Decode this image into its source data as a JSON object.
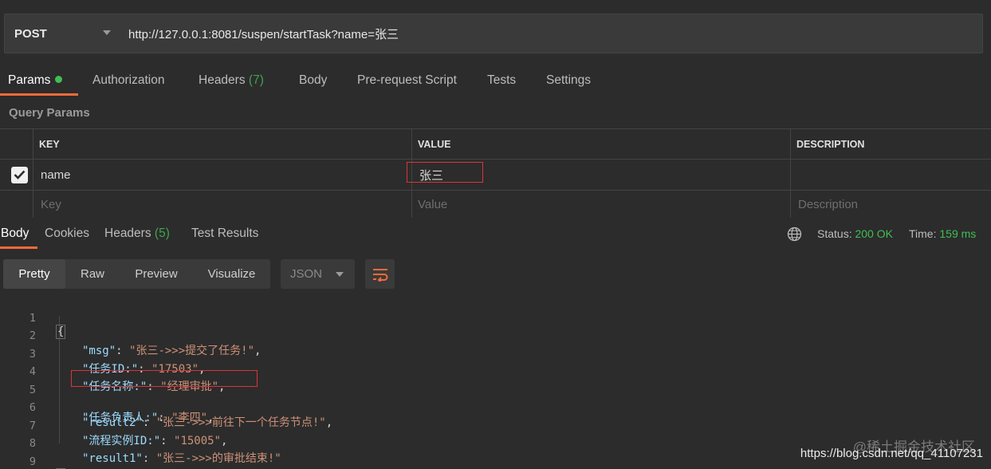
{
  "request": {
    "method": "POST",
    "url": "http://127.0.0.1:8081/suspen/startTask?name=张三"
  },
  "req_tabs": [
    {
      "label": "Params",
      "count": ""
    },
    {
      "label": "Authorization",
      "count": ""
    },
    {
      "label": "Headers",
      "count": "(7)"
    },
    {
      "label": "Body",
      "count": ""
    },
    {
      "label": "Pre-request Script",
      "count": ""
    },
    {
      "label": "Tests",
      "count": ""
    },
    {
      "label": "Settings",
      "count": ""
    }
  ],
  "query_params": {
    "title": "Query Params",
    "columns": [
      "KEY",
      "VALUE",
      "DESCRIPTION"
    ],
    "rows": [
      {
        "key": "name",
        "value": "张三",
        "description": ""
      }
    ],
    "placeholders": {
      "key": "Key",
      "value": "Value",
      "description": "Description"
    }
  },
  "res_tabs": [
    {
      "label": "Body",
      "count": ""
    },
    {
      "label": "Cookies",
      "count": ""
    },
    {
      "label": "Headers",
      "count": "(5)"
    },
    {
      "label": "Test Results",
      "count": ""
    }
  ],
  "status": {
    "status_label": "Status:",
    "status_value": "200 OK",
    "time_label": "Time:",
    "time_value": "159 ms"
  },
  "view_modes": [
    "Pretty",
    "Raw",
    "Preview",
    "Visualize"
  ],
  "format": "JSON",
  "code_lines": [
    {
      "n": "1",
      "key": "",
      "value": "",
      "raw": "{"
    },
    {
      "n": "2",
      "key": "\"msg\"",
      "value": "\"张三->>>提交了任务!\"",
      "raw": ""
    },
    {
      "n": "3",
      "key": "\"任务ID:\"",
      "value": "\"17503\"",
      "raw": ""
    },
    {
      "n": "4",
      "key": "\"任务名称:\"",
      "value": "\"经理审批\"",
      "raw": ""
    },
    {
      "n": "5",
      "key": "\"任务负责人:\"",
      "value": "\"李四\"",
      "raw": ""
    },
    {
      "n": "6",
      "key": "\"result2\"",
      "value": "\"张三->>>前往下一个任务节点!\"",
      "raw": ""
    },
    {
      "n": "7",
      "key": "\"流程实例ID:\"",
      "value": "\"15005\"",
      "raw": ""
    },
    {
      "n": "8",
      "key": "\"result1\"",
      "value": "\"张三->>>的审批结束!\"",
      "raw": ""
    },
    {
      "n": "9",
      "key": "",
      "value": "",
      "raw": "}"
    }
  ],
  "watermark": {
    "line1": "@稀土掘金技术社区",
    "line2": "https://blog.csdn.net/qq_41107231"
  },
  "colors": {
    "accent": "#f26b3a",
    "ok": "#3fbe54",
    "json_key": "#9cdcfe",
    "json_string": "#ce9178"
  }
}
